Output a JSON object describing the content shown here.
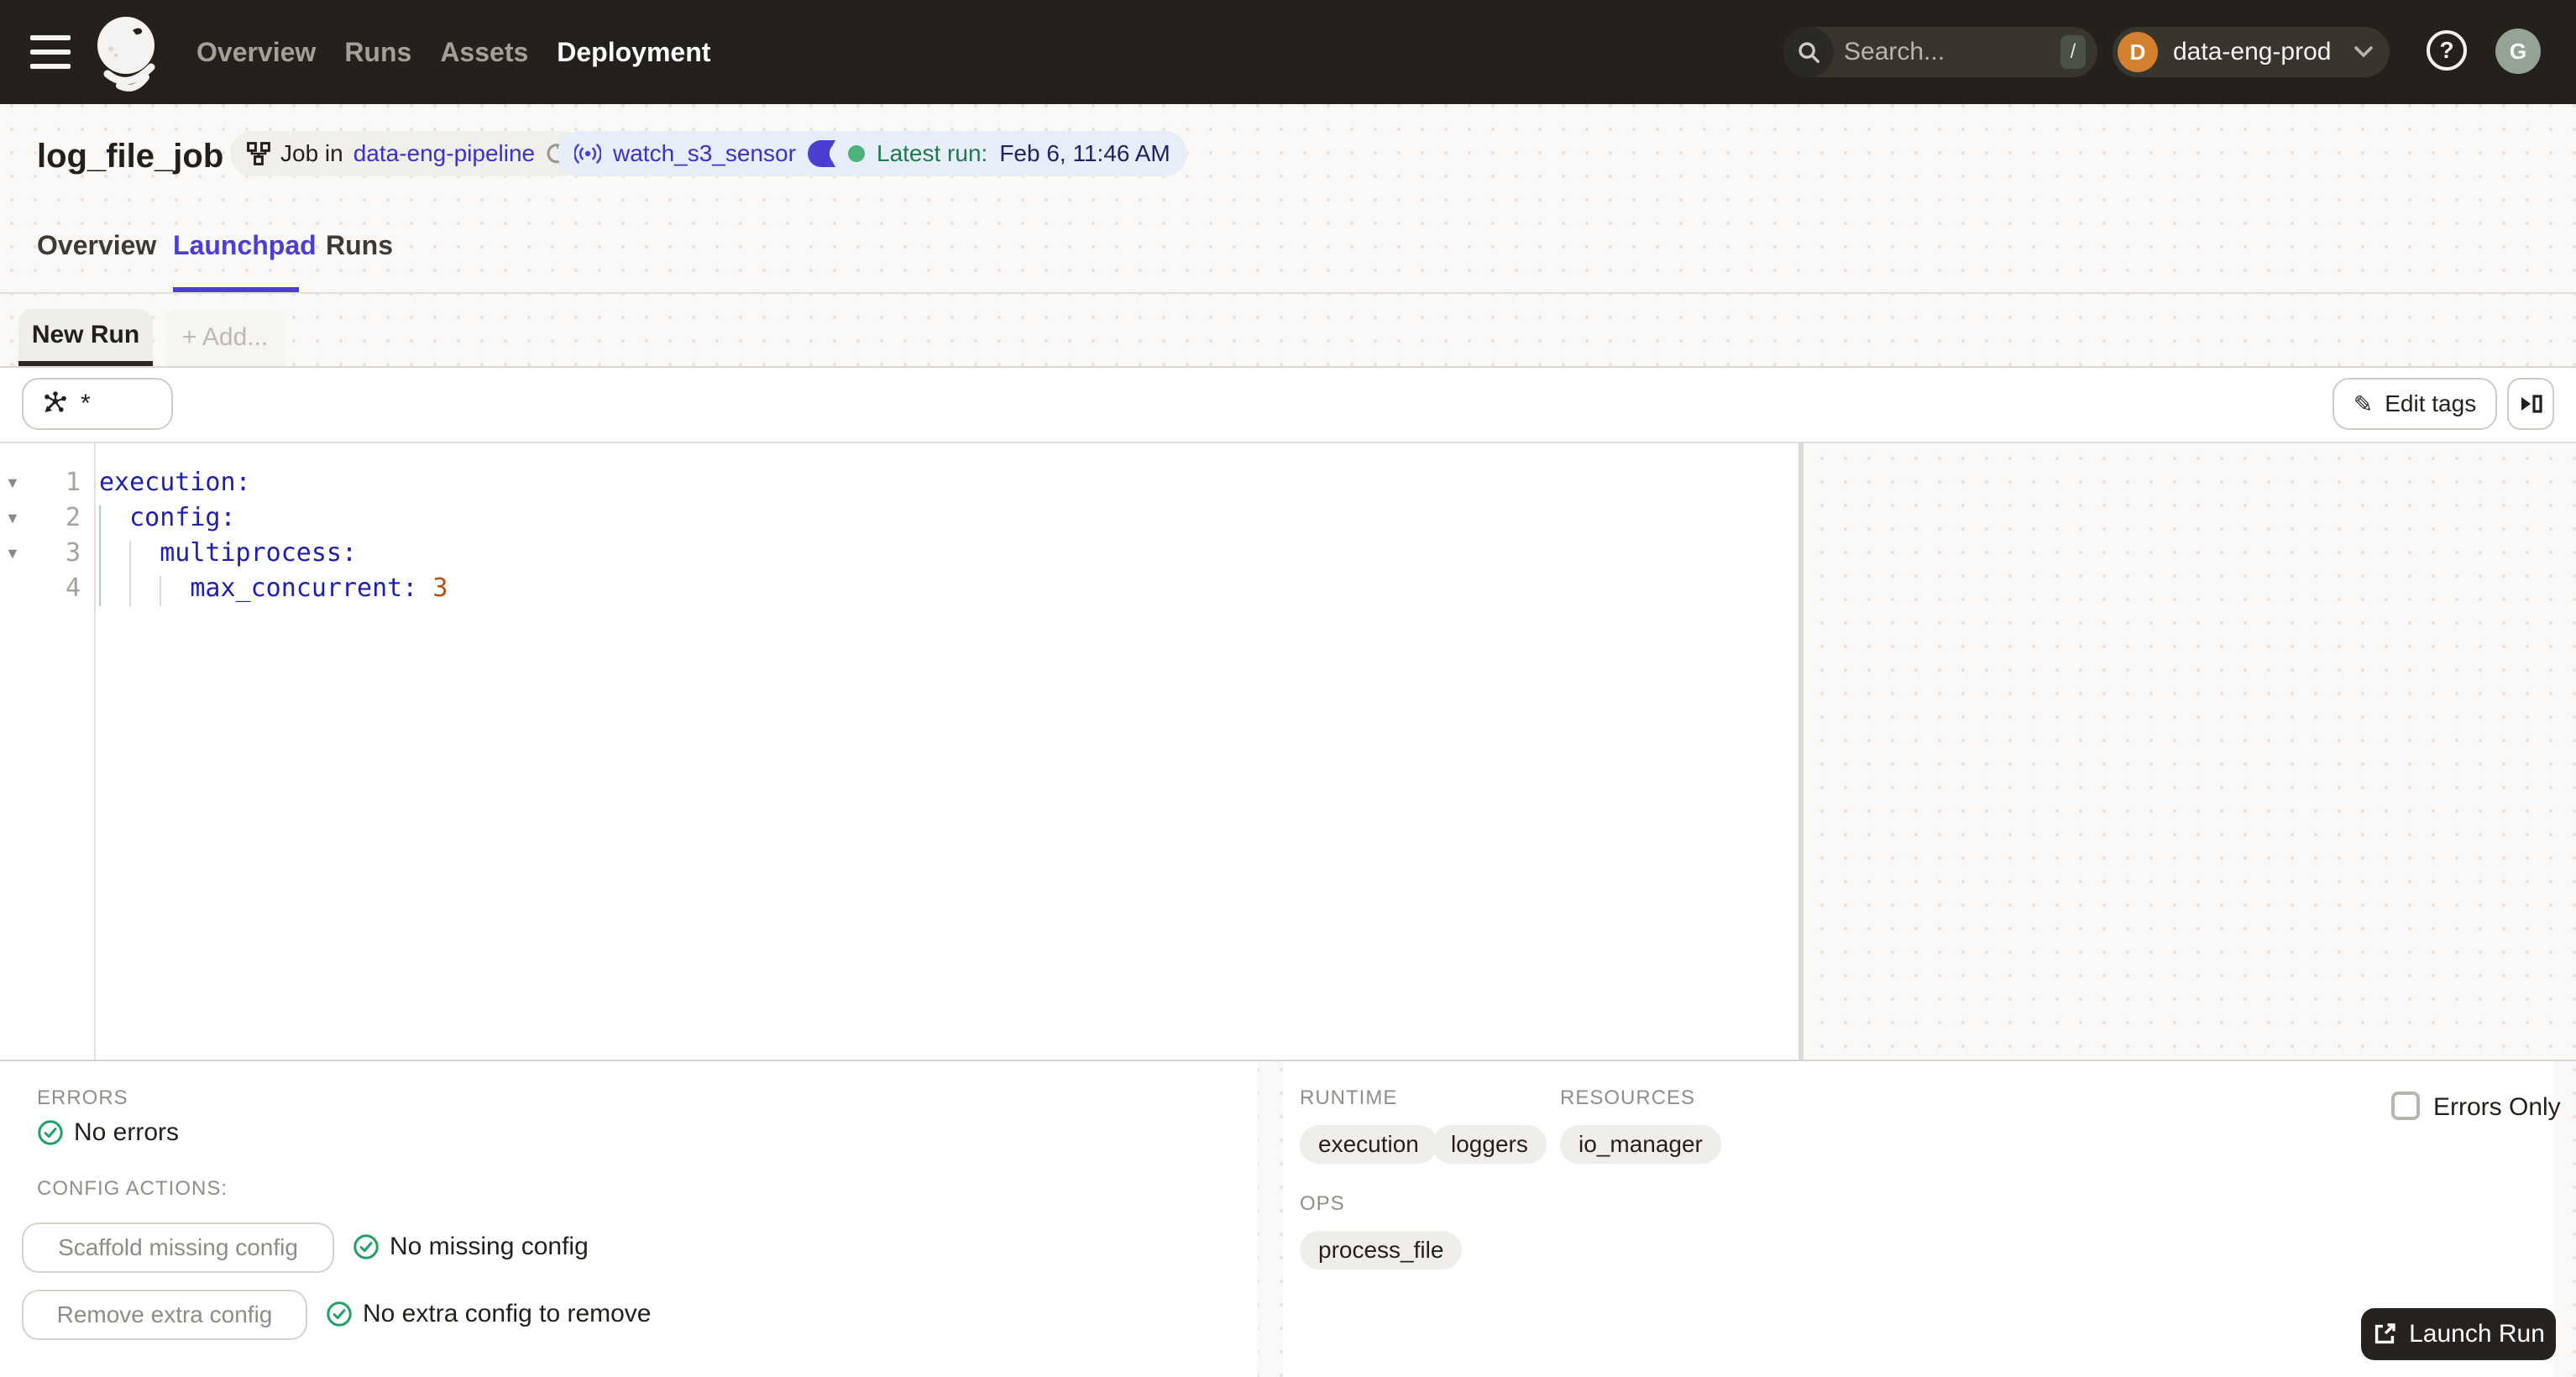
{
  "topbar": {
    "nav": [
      {
        "label": "Overview"
      },
      {
        "label": "Runs"
      },
      {
        "label": "Assets"
      },
      {
        "label": "Deployment"
      }
    ],
    "search": {
      "placeholder": "Search...",
      "shortcut": "/"
    },
    "org": {
      "initial": "D",
      "name": "data-eng-prod"
    },
    "avatar_initial": "G"
  },
  "title": {
    "job_name": "log_file_job",
    "job_pill": {
      "prefix": "Job in",
      "link": "data-eng-pipeline"
    },
    "sensor": {
      "name": "watch_s3_sensor",
      "enabled": true
    },
    "latest_run": {
      "label": "Latest run:",
      "value": "Feb 6, 11:46 AM"
    }
  },
  "tabs": [
    {
      "label": "Overview"
    },
    {
      "label": "Launchpad"
    },
    {
      "label": "Runs"
    }
  ],
  "run_tabs": {
    "active": "New Run",
    "add": "+ Add..."
  },
  "toolbar": {
    "scope": "*",
    "edit_tags": "Edit tags"
  },
  "editor": {
    "lines": [
      {
        "num": "1",
        "key": "execution:",
        "value": ""
      },
      {
        "num": "2",
        "key": "  config:",
        "value": ""
      },
      {
        "num": "3",
        "key": "    multiprocess:",
        "value": ""
      },
      {
        "num": "4",
        "key": "      max_concurrent: ",
        "value": "3"
      }
    ]
  },
  "bottom": {
    "errors": {
      "label": "ERRORS",
      "status": "No errors"
    },
    "config_actions": {
      "label": "CONFIG ACTIONS:",
      "actions": [
        {
          "button": "Scaffold missing config",
          "status": "No missing config"
        },
        {
          "button": "Remove extra config",
          "status": "No extra config to remove"
        }
      ]
    },
    "runtime": {
      "label": "RUNTIME",
      "chips": [
        "execution",
        "loggers"
      ]
    },
    "resources": {
      "label": "RESOURCES",
      "chips": [
        "io_manager"
      ]
    },
    "ops": {
      "label": "OPS",
      "chips": [
        "process_file"
      ]
    },
    "errors_only_label": "Errors Only",
    "launch_label": "Launch Run"
  },
  "colors": {
    "accent": "#4a3fd0",
    "link": "#3a31c8",
    "green": "#21a065",
    "topbar": "#24211d",
    "orange": "#d3812e"
  }
}
